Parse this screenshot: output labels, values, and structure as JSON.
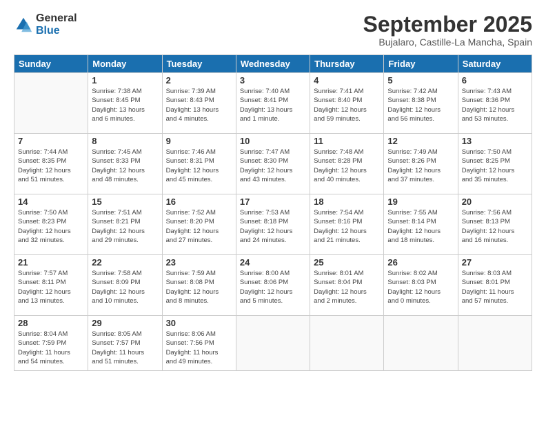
{
  "logo": {
    "general": "General",
    "blue": "Blue"
  },
  "title": "September 2025",
  "location": "Bujalaro, Castille-La Mancha, Spain",
  "days_of_week": [
    "Sunday",
    "Monday",
    "Tuesday",
    "Wednesday",
    "Thursday",
    "Friday",
    "Saturday"
  ],
  "weeks": [
    [
      {
        "day": "",
        "info": ""
      },
      {
        "day": "1",
        "info": "Sunrise: 7:38 AM\nSunset: 8:45 PM\nDaylight: 13 hours\nand 6 minutes."
      },
      {
        "day": "2",
        "info": "Sunrise: 7:39 AM\nSunset: 8:43 PM\nDaylight: 13 hours\nand 4 minutes."
      },
      {
        "day": "3",
        "info": "Sunrise: 7:40 AM\nSunset: 8:41 PM\nDaylight: 13 hours\nand 1 minute."
      },
      {
        "day": "4",
        "info": "Sunrise: 7:41 AM\nSunset: 8:40 PM\nDaylight: 12 hours\nand 59 minutes."
      },
      {
        "day": "5",
        "info": "Sunrise: 7:42 AM\nSunset: 8:38 PM\nDaylight: 12 hours\nand 56 minutes."
      },
      {
        "day": "6",
        "info": "Sunrise: 7:43 AM\nSunset: 8:36 PM\nDaylight: 12 hours\nand 53 minutes."
      }
    ],
    [
      {
        "day": "7",
        "info": "Sunrise: 7:44 AM\nSunset: 8:35 PM\nDaylight: 12 hours\nand 51 minutes."
      },
      {
        "day": "8",
        "info": "Sunrise: 7:45 AM\nSunset: 8:33 PM\nDaylight: 12 hours\nand 48 minutes."
      },
      {
        "day": "9",
        "info": "Sunrise: 7:46 AM\nSunset: 8:31 PM\nDaylight: 12 hours\nand 45 minutes."
      },
      {
        "day": "10",
        "info": "Sunrise: 7:47 AM\nSunset: 8:30 PM\nDaylight: 12 hours\nand 43 minutes."
      },
      {
        "day": "11",
        "info": "Sunrise: 7:48 AM\nSunset: 8:28 PM\nDaylight: 12 hours\nand 40 minutes."
      },
      {
        "day": "12",
        "info": "Sunrise: 7:49 AM\nSunset: 8:26 PM\nDaylight: 12 hours\nand 37 minutes."
      },
      {
        "day": "13",
        "info": "Sunrise: 7:50 AM\nSunset: 8:25 PM\nDaylight: 12 hours\nand 35 minutes."
      }
    ],
    [
      {
        "day": "14",
        "info": "Sunrise: 7:50 AM\nSunset: 8:23 PM\nDaylight: 12 hours\nand 32 minutes."
      },
      {
        "day": "15",
        "info": "Sunrise: 7:51 AM\nSunset: 8:21 PM\nDaylight: 12 hours\nand 29 minutes."
      },
      {
        "day": "16",
        "info": "Sunrise: 7:52 AM\nSunset: 8:20 PM\nDaylight: 12 hours\nand 27 minutes."
      },
      {
        "day": "17",
        "info": "Sunrise: 7:53 AM\nSunset: 8:18 PM\nDaylight: 12 hours\nand 24 minutes."
      },
      {
        "day": "18",
        "info": "Sunrise: 7:54 AM\nSunset: 8:16 PM\nDaylight: 12 hours\nand 21 minutes."
      },
      {
        "day": "19",
        "info": "Sunrise: 7:55 AM\nSunset: 8:14 PM\nDaylight: 12 hours\nand 18 minutes."
      },
      {
        "day": "20",
        "info": "Sunrise: 7:56 AM\nSunset: 8:13 PM\nDaylight: 12 hours\nand 16 minutes."
      }
    ],
    [
      {
        "day": "21",
        "info": "Sunrise: 7:57 AM\nSunset: 8:11 PM\nDaylight: 12 hours\nand 13 minutes."
      },
      {
        "day": "22",
        "info": "Sunrise: 7:58 AM\nSunset: 8:09 PM\nDaylight: 12 hours\nand 10 minutes."
      },
      {
        "day": "23",
        "info": "Sunrise: 7:59 AM\nSunset: 8:08 PM\nDaylight: 12 hours\nand 8 minutes."
      },
      {
        "day": "24",
        "info": "Sunrise: 8:00 AM\nSunset: 8:06 PM\nDaylight: 12 hours\nand 5 minutes."
      },
      {
        "day": "25",
        "info": "Sunrise: 8:01 AM\nSunset: 8:04 PM\nDaylight: 12 hours\nand 2 minutes."
      },
      {
        "day": "26",
        "info": "Sunrise: 8:02 AM\nSunset: 8:03 PM\nDaylight: 12 hours\nand 0 minutes."
      },
      {
        "day": "27",
        "info": "Sunrise: 8:03 AM\nSunset: 8:01 PM\nDaylight: 11 hours\nand 57 minutes."
      }
    ],
    [
      {
        "day": "28",
        "info": "Sunrise: 8:04 AM\nSunset: 7:59 PM\nDaylight: 11 hours\nand 54 minutes."
      },
      {
        "day": "29",
        "info": "Sunrise: 8:05 AM\nSunset: 7:57 PM\nDaylight: 11 hours\nand 51 minutes."
      },
      {
        "day": "30",
        "info": "Sunrise: 8:06 AM\nSunset: 7:56 PM\nDaylight: 11 hours\nand 49 minutes."
      },
      {
        "day": "",
        "info": ""
      },
      {
        "day": "",
        "info": ""
      },
      {
        "day": "",
        "info": ""
      },
      {
        "day": "",
        "info": ""
      }
    ]
  ]
}
